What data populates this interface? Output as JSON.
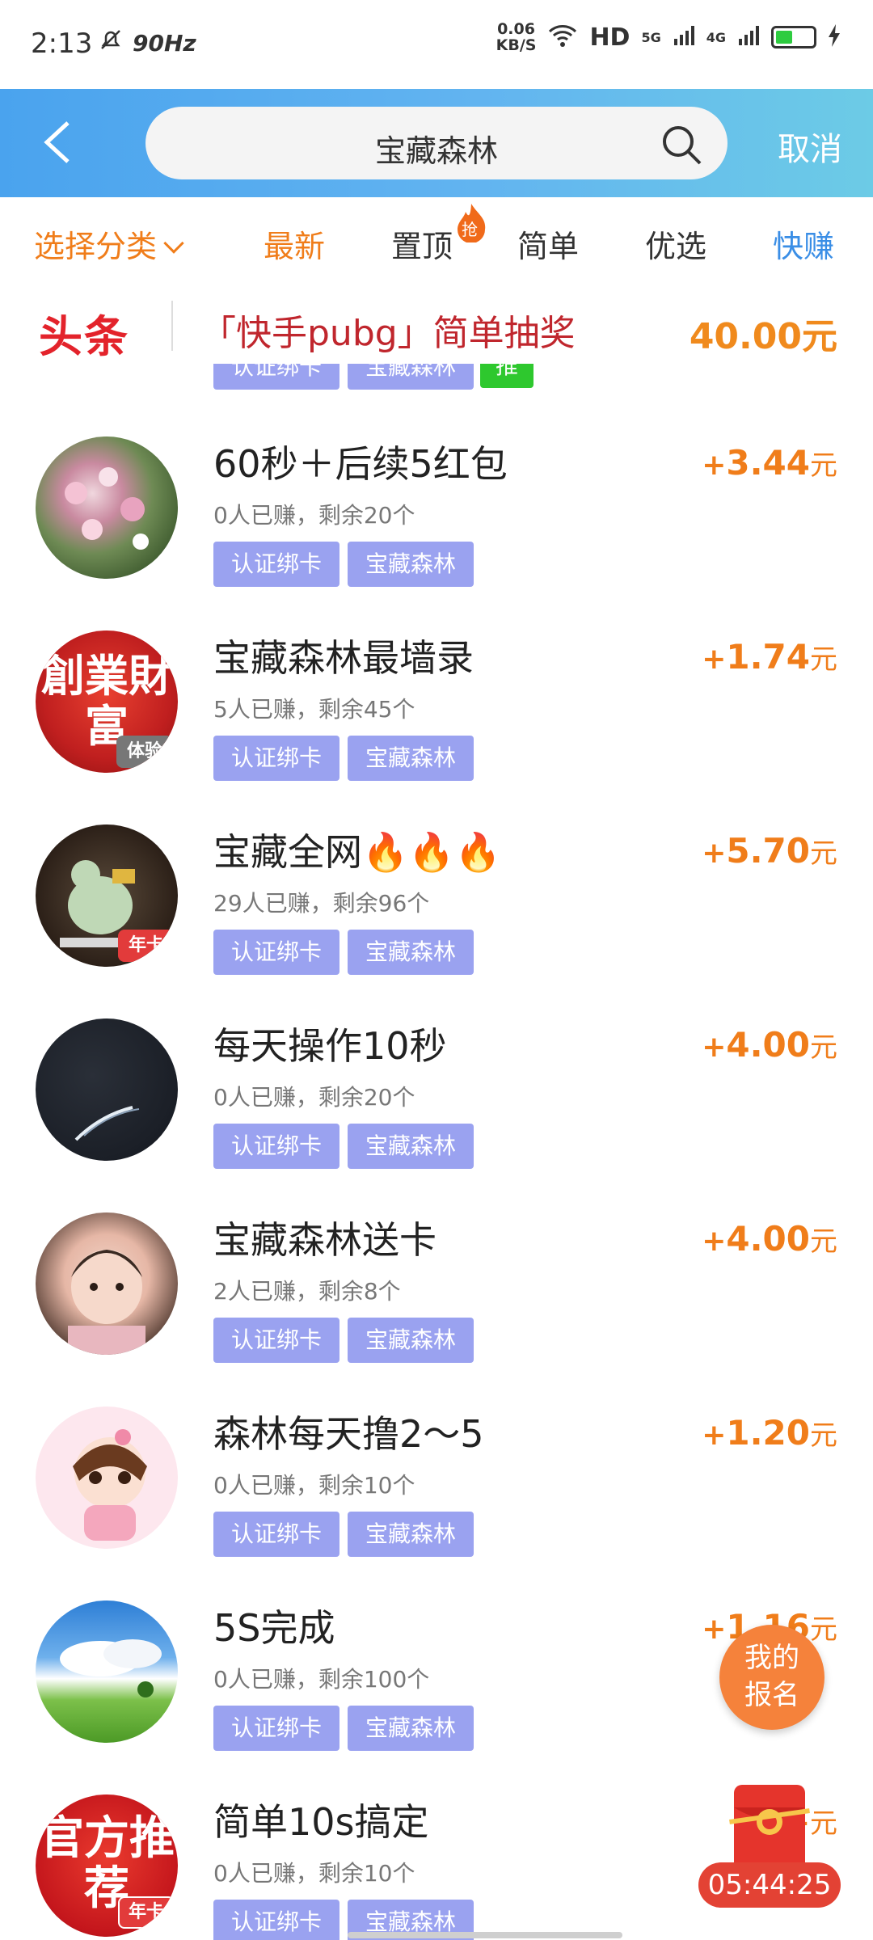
{
  "status_bar": {
    "time": "2:13",
    "refresh": "90Hz",
    "speed_value": "0.06",
    "speed_unit": "KB/S",
    "hd_label": "HD",
    "net1": "5G",
    "net2": "4G"
  },
  "header": {
    "search_query": "宝藏森林",
    "cancel_label": "取消"
  },
  "tabs": [
    {
      "label": "选择分类"
    },
    {
      "label": "最新"
    },
    {
      "label": "置顶"
    },
    {
      "label": "简单"
    },
    {
      "label": "优选"
    },
    {
      "label": "快赚"
    }
  ],
  "hot_badge": "抢",
  "headline": {
    "logo": "头条",
    "text": "「快手pubg」简单抽奖",
    "amount": "40.00元"
  },
  "partial_row": {
    "tag1": "认证绑卡",
    "tag2": "宝藏森林",
    "tag3": "推"
  },
  "items": [
    {
      "title": "60秒＋后续5红包",
      "stats": "0人已赚，剩余20个",
      "reward": "3.44",
      "tag1": "认证绑卡",
      "tag2": "宝藏森林",
      "avatar_label": "",
      "badge": ""
    },
    {
      "title": "宝藏森林最墙录",
      "stats": "5人已赚，剩余45个",
      "reward": "1.74",
      "tag1": "认证绑卡",
      "tag2": "宝藏森林",
      "avatar_label": "創業財富",
      "badge": "体验"
    },
    {
      "title": "宝藏全网🔥🔥🔥",
      "stats": "29人已赚，剩余96个",
      "reward": "5.70",
      "tag1": "认证绑卡",
      "tag2": "宝藏森林",
      "avatar_label": "",
      "badge": "年卡"
    },
    {
      "title": "每天操作10秒",
      "stats": "0人已赚，剩余20个",
      "reward": "4.00",
      "tag1": "认证绑卡",
      "tag2": "宝藏森林",
      "avatar_label": "",
      "badge": ""
    },
    {
      "title": "宝藏森林送卡",
      "stats": "2人已赚，剩余8个",
      "reward": "4.00",
      "tag1": "认证绑卡",
      "tag2": "宝藏森林",
      "avatar_label": "",
      "badge": ""
    },
    {
      "title": "森林每天撸2～5",
      "stats": "0人已赚，剩余10个",
      "reward": "1.20",
      "tag1": "认证绑卡",
      "tag2": "宝藏森林",
      "avatar_label": "",
      "badge": ""
    },
    {
      "title": "5S完成",
      "stats": "0人已赚，剩余100个",
      "reward": "1.16",
      "tag1": "认证绑卡",
      "tag2": "宝藏森林",
      "avatar_label": "",
      "badge": ""
    },
    {
      "title": "简单10s搞定",
      "stats": "0人已赚，剩余10个",
      "reward": "",
      "tag1": "认证绑卡",
      "tag2": "宝藏森林",
      "avatar_label": "官方推荐",
      "badge": "年卡"
    }
  ],
  "reward_plus": "+",
  "reward_unit": "元",
  "fab_label": "我的报名",
  "countdown": "05:44:25"
}
